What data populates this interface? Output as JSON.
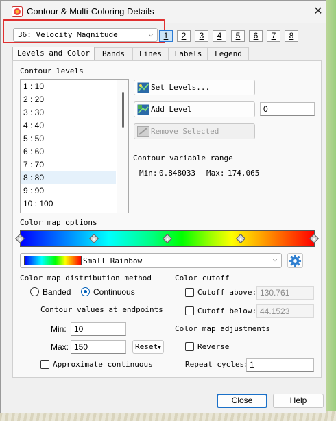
{
  "window": {
    "title": "Contour & Multi-Coloring Details",
    "close_glyph": "✕"
  },
  "variable_select": {
    "value": "36: Velocity Magnitude"
  },
  "pages": [
    "1",
    "2",
    "3",
    "4",
    "5",
    "6",
    "7",
    "8"
  ],
  "tabs": [
    "Levels and Color",
    "Bands",
    "Lines",
    "Labels",
    "Legend"
  ],
  "contour_levels": {
    "heading": "Contour levels",
    "items": [
      "1 : 10",
      "2 : 20",
      "3 : 30",
      "4 : 40",
      "5 : 50",
      "6 : 60",
      "7 : 70",
      "8 : 80",
      "9 : 90",
      "10 : 100"
    ],
    "selected_index": 7
  },
  "buttons": {
    "set_levels": "Set Levels...",
    "add_level": "Add Level",
    "remove_selected": "Remove Selected",
    "reset": "Reset",
    "close": "Close",
    "help": "Help"
  },
  "add_level_value": "0",
  "range": {
    "heading": "Contour variable range",
    "min_label": "Min:",
    "min_value": "0.848033",
    "max_label": "Max:",
    "max_value": "174.065"
  },
  "color_map": {
    "options_label": "Color map options",
    "selected": "Small Rainbow"
  },
  "distribution": {
    "heading": "Color map distribution method",
    "banded": "Banded",
    "continuous": "Continuous",
    "selected": "Continuous",
    "endpoints_heading": "Contour values at endpoints",
    "min_label": "Min:",
    "min_value": "10",
    "max_label": "Max:",
    "max_value": "150",
    "approximate": "Approximate continuous",
    "approximate_checked": false
  },
  "cutoff": {
    "heading": "Color cutoff",
    "above_label": "Cutoff above:",
    "above_value": "130.761",
    "above_checked": false,
    "below_label": "Cutoff below:",
    "below_value": "44.1523",
    "below_checked": false
  },
  "adjustments": {
    "heading": "Color map adjustments",
    "reverse": "Reverse",
    "reverse_checked": false,
    "repeat_label": "Repeat cycles:",
    "repeat_value": "1"
  },
  "colors": {
    "accent": "#005fb8",
    "highlight_box": "#e03030"
  }
}
